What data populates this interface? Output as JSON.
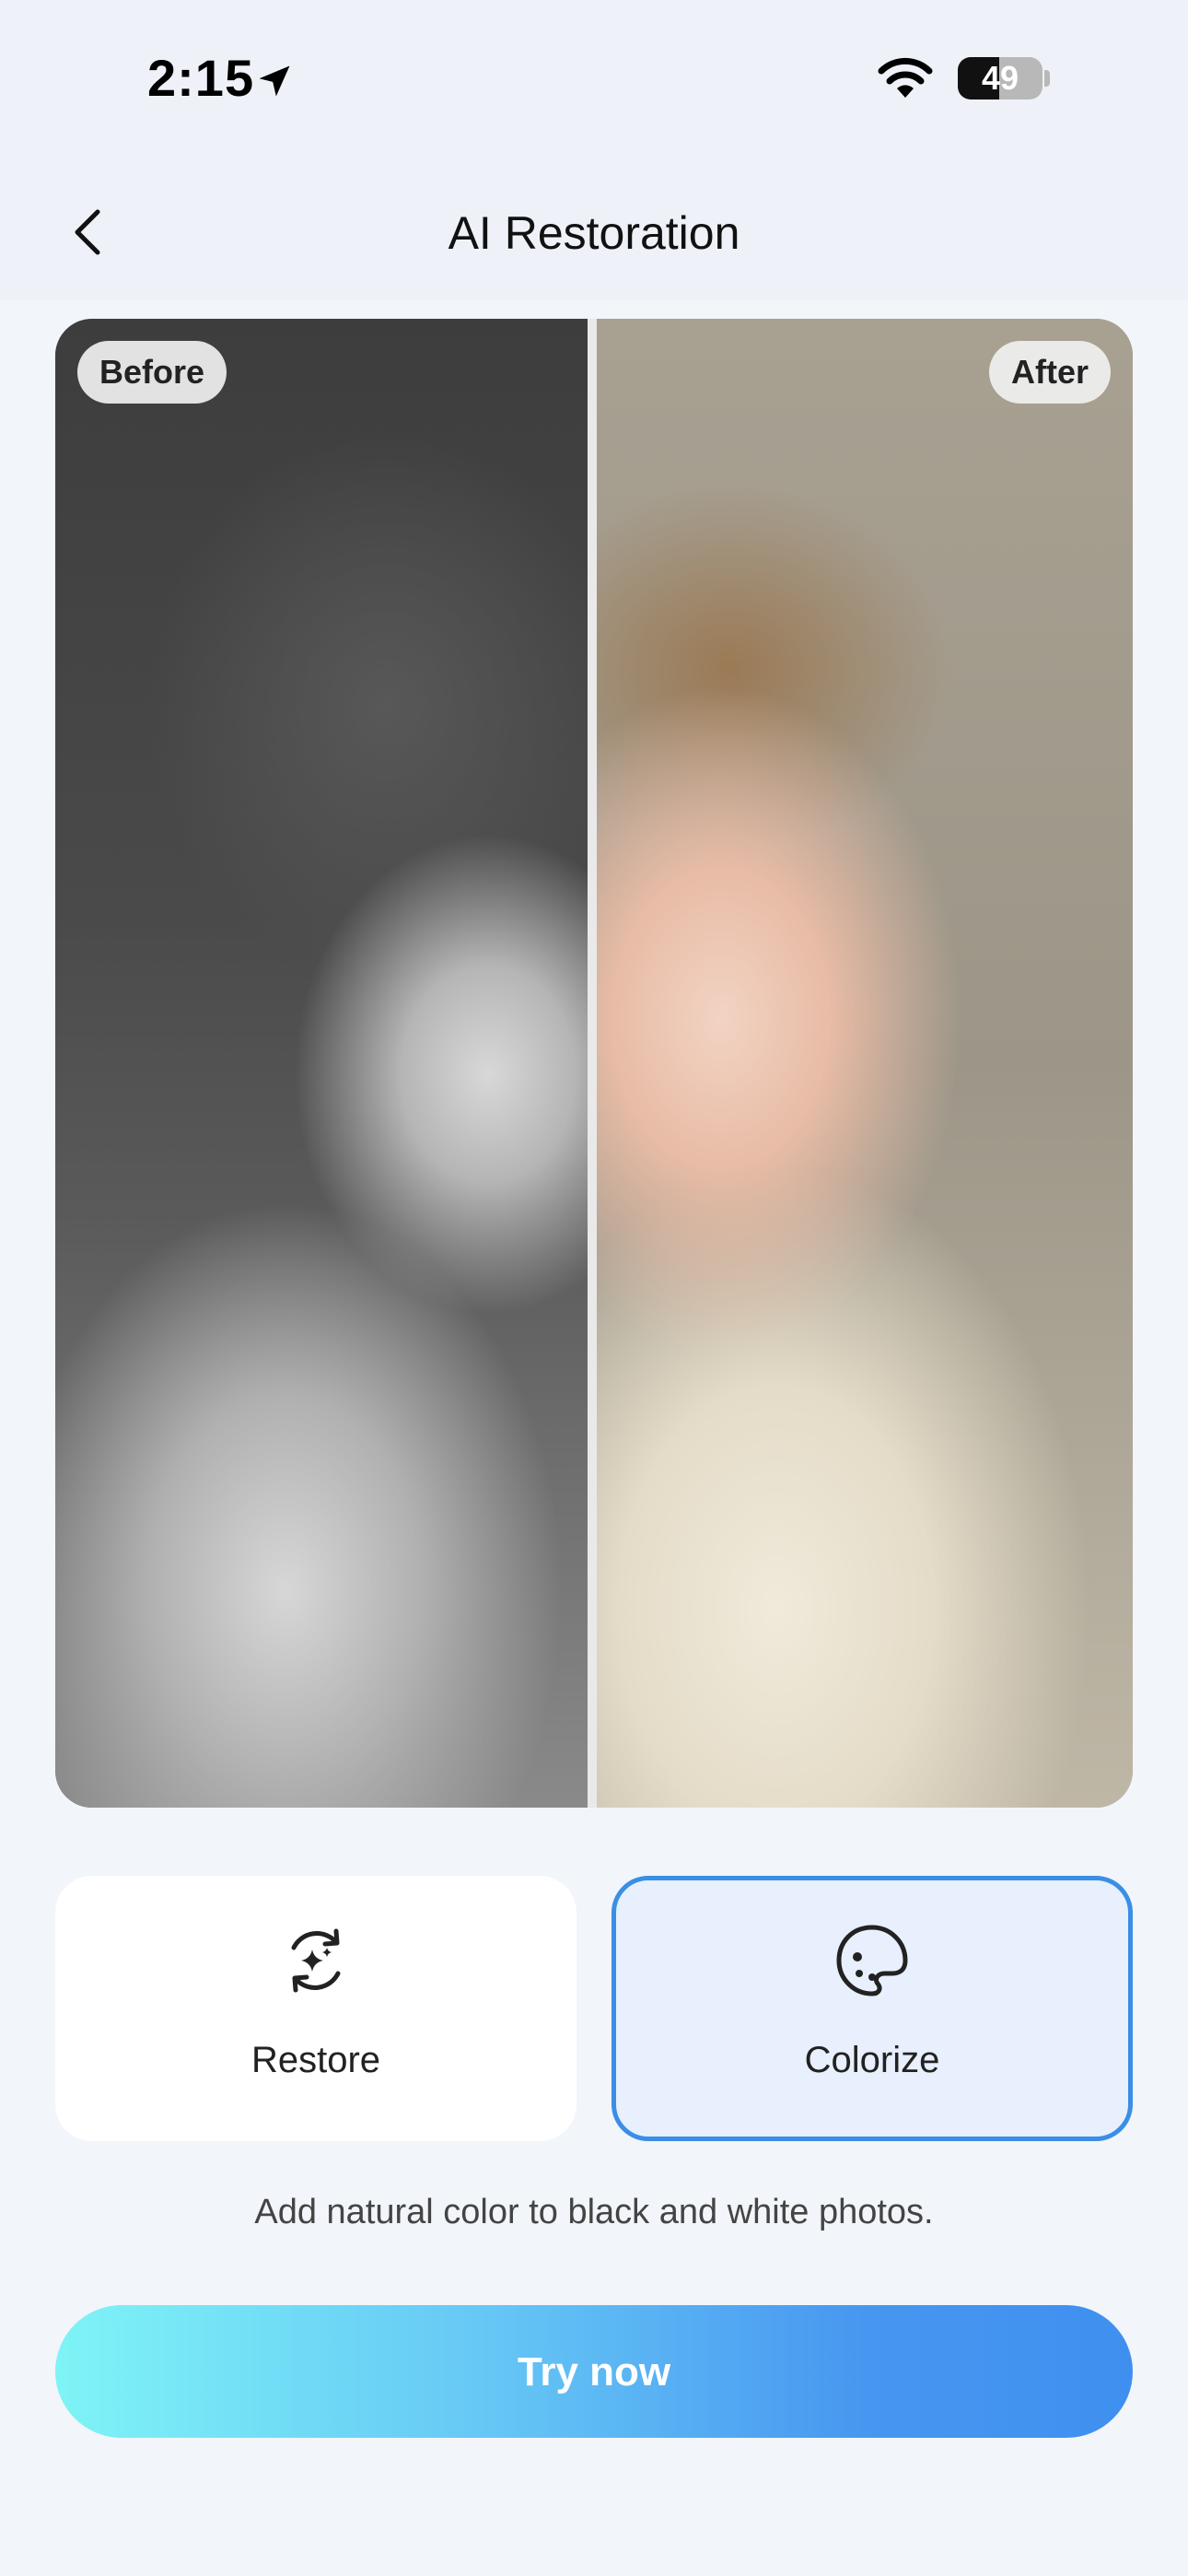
{
  "status_bar": {
    "time": "2:15",
    "battery_percent": "49",
    "battery_level": 0.49
  },
  "nav": {
    "title": "AI Restoration"
  },
  "compare": {
    "before_label": "Before",
    "after_label": "After"
  },
  "options": [
    {
      "label": "Restore",
      "icon": "sparkle-refresh-icon",
      "selected": false
    },
    {
      "label": "Colorize",
      "icon": "palette-icon",
      "selected": true
    }
  ],
  "description": "Add natural color to black and white photos.",
  "cta": {
    "label": "Try now"
  },
  "colors": {
    "accent": "#3a8ee6",
    "selected_bg": "#e7f0fc",
    "page_bg": "#f2f5fa",
    "cta_gradient_start": "#7ef4f6",
    "cta_gradient_end": "#3f8ff0"
  }
}
